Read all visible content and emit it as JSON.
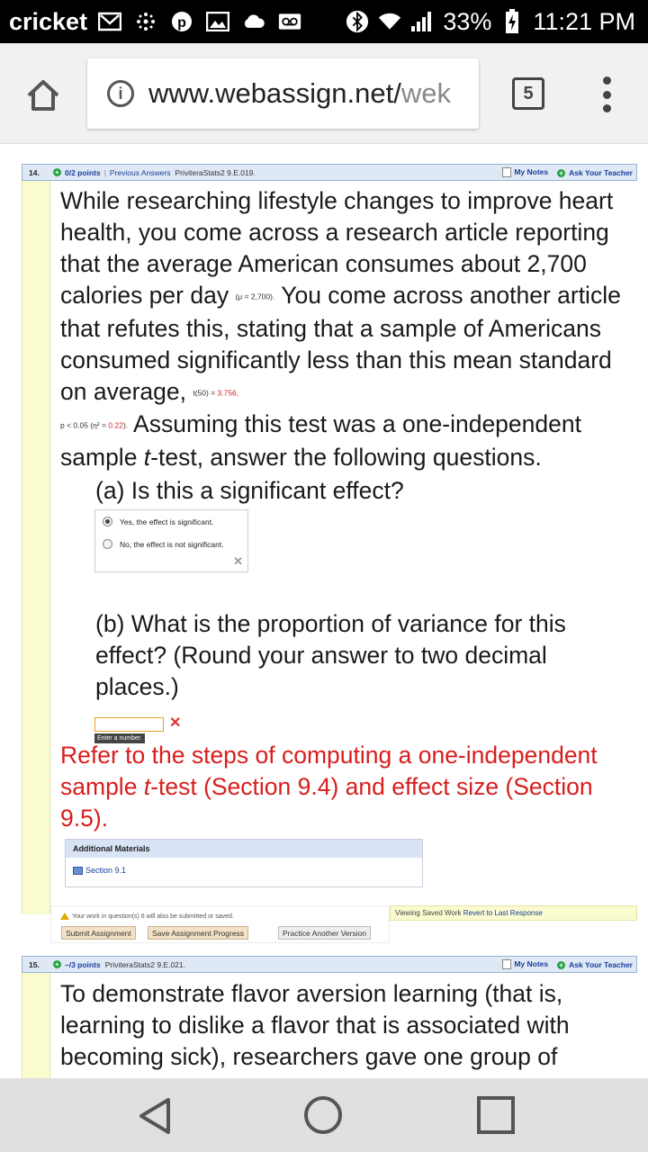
{
  "status": {
    "carrier": "cricket",
    "battery": "33%",
    "time": "11:21 PM"
  },
  "browser": {
    "url_main": "www.webassign.net/",
    "url_dim": "wek",
    "tab_count": "5"
  },
  "q14": {
    "number": "14.",
    "points": "0/2 points",
    "separator": "|",
    "previous_answers": "Previous Answers",
    "qid": "PriviteraStats2 9.E.019.",
    "my_notes": "My Notes",
    "ask_teacher": "Ask Your Teacher",
    "text_1": "While researching lifestyle changes to improve heart health, you come across a research article reporting that the average American consumes about 2,700 calories per day",
    "mu_note": "(μ = 2,700).",
    "text_2": " You come across another article that refutes this, stating that a sample of Americans consumed significantly less than this mean standard on average,",
    "t_note_pre": "t(50) = ",
    "t_value": "3.756,",
    "p_note_pre": "p < 0.05 (η² = ",
    "eta_value": "0.22",
    "p_note_post": ").",
    "text_3": " Assuming this test was a one-independent sample ",
    "text_3_t": "t",
    "text_3_end": "-test, answer the following questions.",
    "part_a": "(a) Is this a significant effect?",
    "option_yes": "Yes, the effect is significant.",
    "option_no": "No, the effect is not significant.",
    "part_b": "(b) What is the proportion of variance for this effect? (Round your answer to two decimal places.)",
    "input_value": "",
    "input_tooltip": "Enter a number.",
    "feedback_1": "Refer to the steps of computing a one-independent sample ",
    "feedback_t": "t",
    "feedback_2": "-test (Section 9.4) and effect size (Section 9.5).",
    "additional_materials": "Additional Materials",
    "section_link": "Section 9.1",
    "warning": "Your work in question(s) 6 will also be submitted or saved.",
    "btn_submit": "Submit Assignment",
    "btn_save": "Save Assignment Progress",
    "btn_practice": "Practice Another Version",
    "viewing_text": "Viewing Saved Work",
    "revert_link": "Revert to Last Response"
  },
  "q15": {
    "number": "15.",
    "points": "–/3 points",
    "qid": "PriviteraStats2 9.E.021.",
    "my_notes": "My Notes",
    "ask_teacher": "Ask Your Teacher",
    "text": "To demonstrate flavor aversion learning (that is, learning to dislike a flavor that is associated with becoming sick), researchers gave one group of"
  }
}
